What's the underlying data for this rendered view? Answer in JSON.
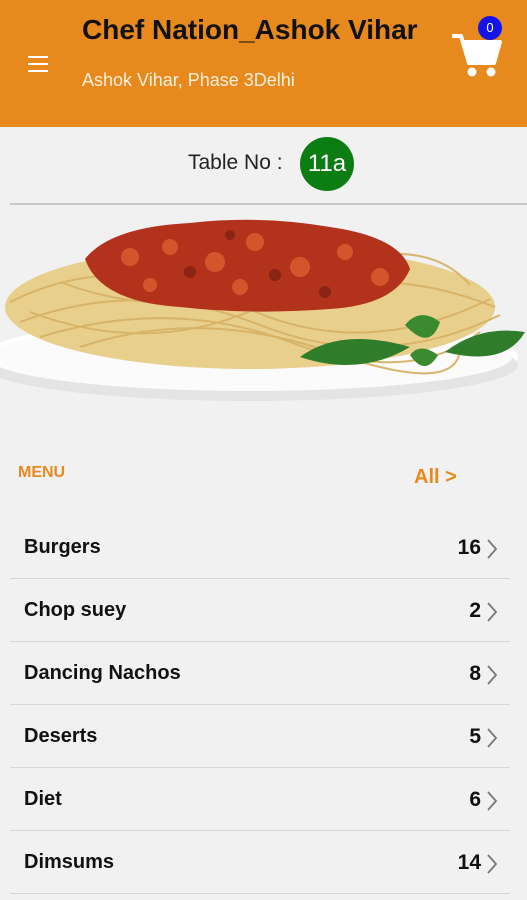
{
  "header": {
    "title": "Chef Nation_Ashok Vihar",
    "subtitle": "Ashok Vihar, Phase 3Delhi",
    "cart_count": "0",
    "menu_icon": "hamburger-icon",
    "cart_icon": "cart-icon"
  },
  "table": {
    "label": "Table No :",
    "number": "11a"
  },
  "menu": {
    "label": "MENU",
    "all_link": "All >",
    "categories": [
      {
        "name": "Burgers",
        "count": "16"
      },
      {
        "name": "Chop suey",
        "count": "2"
      },
      {
        "name": "Dancing Nachos",
        "count": "8"
      },
      {
        "name": "Deserts",
        "count": "5"
      },
      {
        "name": "Diet",
        "count": "6"
      },
      {
        "name": "Dimsums",
        "count": "14"
      }
    ]
  },
  "colors": {
    "brand": "#e8891e",
    "table_badge": "#0c7d12",
    "cart_badge": "#1414e6"
  }
}
